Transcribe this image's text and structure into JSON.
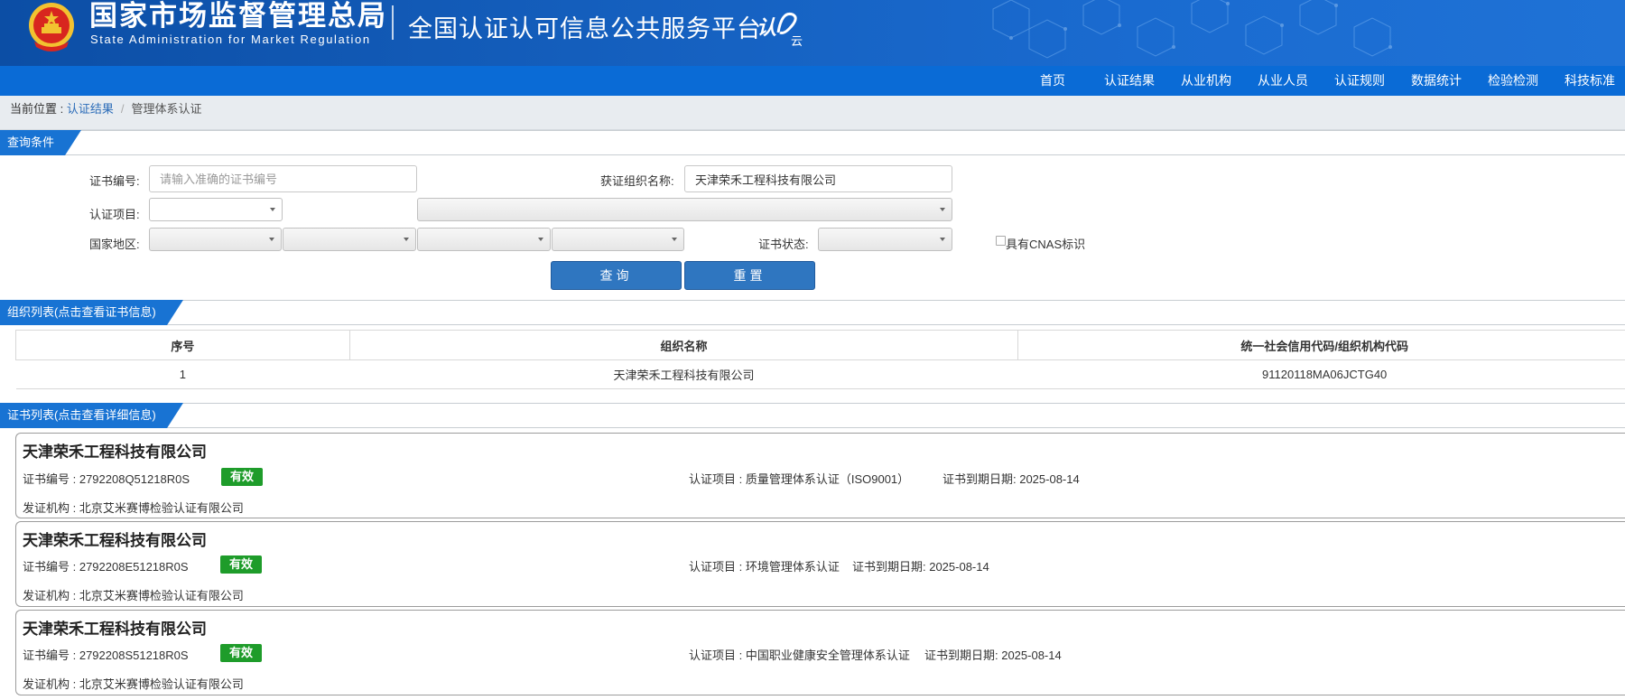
{
  "header": {
    "agency_cn": "国家市场监督管理总局",
    "agency_en": "State Administration for Market Regulation",
    "platform_title": "全国认证认可信息公共服务平台",
    "logo_text_1": "认",
    "logo_text_2": "云",
    "brand_color": "#1560bf"
  },
  "nav": {
    "items": [
      "首页",
      "认证结果",
      "从业机构",
      "从业人员",
      "认证规则",
      "数据统计",
      "检验检测",
      "科技标准"
    ]
  },
  "breadcrumb": {
    "prefix": "当前位置 : ",
    "link": "认证结果",
    "separator": "/",
    "current": "管理体系认证"
  },
  "query": {
    "section_title": "查询条件",
    "cert_no_label": "证书编号:",
    "cert_no_placeholder": "请输入准确的证书编号",
    "org_name_label": "获证组织名称:",
    "org_name_value": "天津荣禾工程科技有限公司",
    "project_label": "认证项目:",
    "region_label": "国家地区:",
    "status_label": "证书状态:",
    "cnas_label": "具有CNAS标识",
    "search_button": "查询",
    "reset_button": "重置"
  },
  "org_list": {
    "section_title": "组织列表(点击查看证书信息)",
    "columns": [
      "序号",
      "组织名称",
      "统一社会信用代码/组织机构代码"
    ],
    "rows": [
      {
        "index": "1",
        "name": "天津荣禾工程科技有限公司",
        "code": "91120118MA06JCTG40"
      }
    ]
  },
  "cert_list": {
    "section_title": "证书列表(点击查看详细信息)",
    "status_color": "#1e9c2a",
    "certs": [
      {
        "org": "天津荣禾工程科技有限公司",
        "cert_no": "证书编号 : 2792208Q51218R0S",
        "status": "有效",
        "project": "认证项目 : 质量管理体系认证（ISO9001）",
        "expiry": "证书到期日期: 2025-08-14",
        "issuer": "发证机构 : 北京艾米赛博检验认证有限公司"
      },
      {
        "org": "天津荣禾工程科技有限公司",
        "cert_no": "证书编号 : 2792208E51218R0S",
        "status": "有效",
        "project": "认证项目 : 环境管理体系认证",
        "expiry": "证书到期日期: 2025-08-14",
        "issuer": "发证机构 : 北京艾米赛博检验认证有限公司"
      },
      {
        "org": "天津荣禾工程科技有限公司",
        "cert_no": "证书编号 : 2792208S51218R0S",
        "status": "有效",
        "project": "认证项目 : 中国职业健康安全管理体系认证",
        "expiry": "证书到期日期: 2025-08-14",
        "issuer": "发证机构 : 北京艾米赛博检验认证有限公司"
      }
    ]
  }
}
